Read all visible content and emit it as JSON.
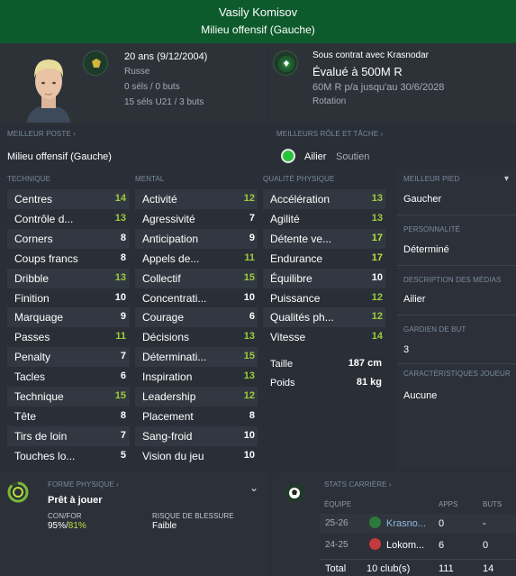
{
  "header": {
    "name": "Vasily Komisov",
    "position": "Milieu offensif (Gauche)"
  },
  "profile": {
    "age": "20 ans (9/12/2004)",
    "nationality": "Russe",
    "caps": "0 séls / 0 buts",
    "u21_caps": "15 séls U21 / 3 buts"
  },
  "contract": {
    "status": "Sous contrat avec Krasnodar",
    "value": "Évalué à 500M R",
    "wage": "60M R p/a jusqu'au 30/6/2028",
    "role": "Rotation"
  },
  "best_position": {
    "label": "MEILLEUR POSTE",
    "value": "Milieu offensif (Gauche)"
  },
  "best_role": {
    "label": "MEILLEURS RÔLE ET TÂCHE",
    "role": "Ailier",
    "duty": "Soutien"
  },
  "sections": {
    "technique": "TECHNIQUE",
    "mental": "MENTAL",
    "physical": "QUALITÉ PHYSIQUE"
  },
  "technique": [
    {
      "name": "Centres",
      "value": "14"
    },
    {
      "name": "Contrôle d...",
      "value": "13"
    },
    {
      "name": "Corners",
      "value": "8"
    },
    {
      "name": "Coups francs",
      "value": "8"
    },
    {
      "name": "Dribble",
      "value": "13"
    },
    {
      "name": "Finition",
      "value": "10"
    },
    {
      "name": "Marquage",
      "value": "9"
    },
    {
      "name": "Passes",
      "value": "11"
    },
    {
      "name": "Penalty",
      "value": "7"
    },
    {
      "name": "Tacles",
      "value": "6"
    },
    {
      "name": "Technique",
      "value": "15"
    },
    {
      "name": "Tête",
      "value": "8"
    },
    {
      "name": "Tirs de loin",
      "value": "7"
    },
    {
      "name": "Touches lo...",
      "value": "5"
    }
  ],
  "mental": [
    {
      "name": "Activité",
      "value": "12"
    },
    {
      "name": "Agressivité",
      "value": "7"
    },
    {
      "name": "Anticipation",
      "value": "9"
    },
    {
      "name": "Appels de...",
      "value": "11"
    },
    {
      "name": "Collectif",
      "value": "15"
    },
    {
      "name": "Concentrati...",
      "value": "10"
    },
    {
      "name": "Courage",
      "value": "6"
    },
    {
      "name": "Décisions",
      "value": "13"
    },
    {
      "name": "Déterminati...",
      "value": "15"
    },
    {
      "name": "Inspiration",
      "value": "13"
    },
    {
      "name": "Leadership",
      "value": "12"
    },
    {
      "name": "Placement",
      "value": "8"
    },
    {
      "name": "Sang-froid",
      "value": "10"
    },
    {
      "name": "Vision du jeu",
      "value": "10"
    }
  ],
  "physical": [
    {
      "name": "Accélération",
      "value": "13"
    },
    {
      "name": "Agilité",
      "value": "13"
    },
    {
      "name": "Détente ve...",
      "value": "17"
    },
    {
      "name": "Endurance",
      "value": "17"
    },
    {
      "name": "Équilibre",
      "value": "10"
    },
    {
      "name": "Puissance",
      "value": "12"
    },
    {
      "name": "Qualités ph...",
      "value": "12"
    },
    {
      "name": "Vitesse",
      "value": "14"
    }
  ],
  "measures": {
    "height_label": "Taille",
    "height": "187 cm",
    "weight_label": "Poids",
    "weight": "81 kg"
  },
  "side": {
    "foot_label": "MEILLEUR PIED",
    "foot": "Gaucher",
    "personality_label": "PERSONNALITÉ",
    "personality": "Déterminé",
    "media_label": "DESCRIPTION DES MÉDIAS",
    "media": "Ailier",
    "keeper_label": "GARDIEN DE BUT",
    "keeper": "3",
    "traits_label": "CARACTÉRISTIQUES JOUEUR",
    "traits": "Aucune"
  },
  "condition": {
    "label": "FORME PHYSIQUE",
    "status": "Prêt à jouer",
    "confor_label": "CON/FOR",
    "con": "95%",
    "for": "81%",
    "injury_label": "RISQUE DE BLESSURE",
    "injury": "Faible"
  },
  "career": {
    "label": "STATS CARRIÈRE",
    "headers": {
      "team": "ÉQUIPE",
      "apps": "APPS",
      "goals": "BUTS"
    },
    "rows": [
      {
        "season": "25-26",
        "team": "Krasno...",
        "apps": "0",
        "goals": "-"
      },
      {
        "season": "24-25",
        "team": "Lokom...",
        "apps": "6",
        "goals": "0"
      }
    ],
    "total": {
      "label": "Total",
      "clubs": "10 club(s)",
      "apps": "111",
      "goals": "14"
    }
  },
  "colors": {
    "header": "#0d5a2c",
    "accent_green": "#9ccc3c",
    "bright_green": "#b6e33a",
    "ring": "#7ab83a"
  }
}
